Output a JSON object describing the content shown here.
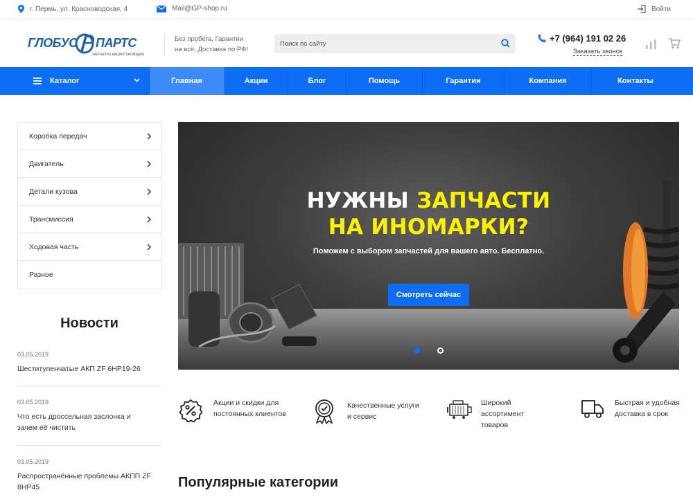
{
  "topbar": {
    "address": "г. Пермь, ул. Красноводская, 4",
    "email": "Mail@GP-shop.ru",
    "login": "Войти"
  },
  "header": {
    "logo_left": "ГЛОБУС",
    "logo_right": "ПАРТС",
    "logo_tagline": "запчасти вашей иномарки",
    "slogan_line1": "Без пробега, Гарантии",
    "slogan_line2": "на всё, Доставка по РФ!",
    "search_placeholder": "Поиск по сайту",
    "phone": "+7 (964) 191 02 26",
    "callback": "Заказать звонок"
  },
  "nav": {
    "catalog": "Каталог",
    "items": [
      "Главная",
      "Акции",
      "Блог",
      "Помощь",
      "Гарантии",
      "Компания",
      "Контакты"
    ],
    "active_index": 0
  },
  "sidebar": {
    "categories": [
      "Коробка передач",
      "Двигатель",
      "Детали кузова",
      "Трансмиссия",
      "Ходовая часть",
      "Разное"
    ]
  },
  "news": {
    "title": "Новости",
    "items": [
      {
        "date": "03.05.2019",
        "title": "Шеститупенчатые АКП ZF 6HP19-26"
      },
      {
        "date": "03.05.2019",
        "title": "Что есть дроссельная заслонка и зачем её чистить"
      },
      {
        "date": "03.05.2019",
        "title": "Распространённые проблемы АКПП ZF 8HP45"
      }
    ]
  },
  "banner": {
    "line1_white": "НУЖНЫ ",
    "line1_yellow": "ЗАПЧАСТИ",
    "line2_yellow": "НА ИНОМАРКИ?",
    "subtitle": "Поможем с выбором запчастей для вашего авто. Бесплатно.",
    "cta": "Смотреть сейчас",
    "slides": 2,
    "active_slide": 0
  },
  "features": [
    {
      "icon": "discount-badge-icon",
      "text": "Акции и скидки для постоянных клиентов"
    },
    {
      "icon": "quality-award-icon",
      "text": "Качественные услуги и сервис"
    },
    {
      "icon": "engine-icon",
      "text": "Широкий ассортимент товаров"
    },
    {
      "icon": "delivery-truck-icon",
      "text": "Быстрая и удобная доставка в срок"
    }
  ],
  "popular": {
    "title": "Популярные категории"
  },
  "colors": {
    "accent": "#0d6df5",
    "accent_active": "#3d8bf8",
    "banner_yellow": "#fff200",
    "logo_blue": "#1f5fa8"
  }
}
